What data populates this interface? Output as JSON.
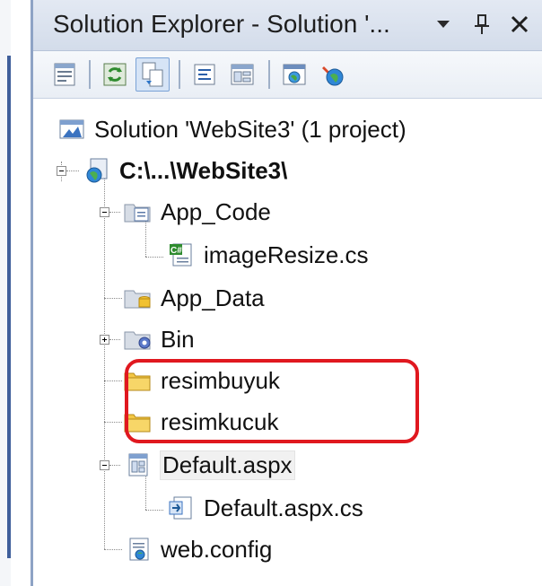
{
  "panel": {
    "title": "Solution Explorer - Solution '...",
    "controls": [
      "dropdown-arrow",
      "pin",
      "close"
    ]
  },
  "toolbar": {
    "buttons": [
      {
        "name": "properties-icon"
      },
      {
        "name": "refresh-icon"
      },
      {
        "name": "nest-related-files-icon",
        "active": true
      },
      {
        "name": "view-code-icon"
      },
      {
        "name": "view-designer-icon"
      },
      {
        "name": "view-in-browser-icon"
      },
      {
        "name": "asp-net-configuration-icon"
      }
    ]
  },
  "tree": {
    "solution": "Solution 'WebSite3' (1 project)",
    "project": "C:\\...\\WebSite3\\",
    "app_code": "App_Code",
    "image_resize": "imageResize.cs",
    "app_data": "App_Data",
    "bin": "Bin",
    "resimbuyuk": "resimbuyuk",
    "resimkucuk": "resimkucuk",
    "default_aspx": "Default.aspx",
    "default_aspx_cs": "Default.aspx.cs",
    "web_config": "web.config"
  },
  "colors": {
    "highlight": "#e0181f",
    "folder": "#f3c744",
    "toolbar_active": "#d6e4f6"
  }
}
